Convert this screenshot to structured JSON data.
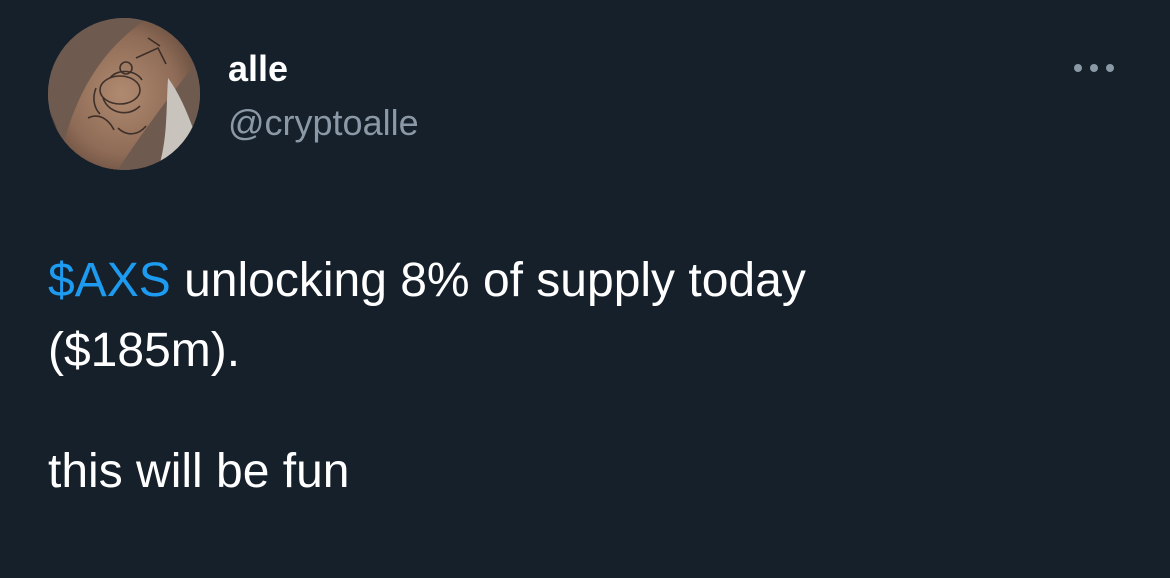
{
  "author": {
    "display_name": "alle",
    "handle": "@cryptoalle",
    "avatar_icon": "tattooed-arm-avatar-icon"
  },
  "more_icon": "ellipsis-icon",
  "tweet": {
    "line1_cashtag": "$AXS",
    "line1_rest": " unlocking 8% of supply today",
    "line2": "($185m).",
    "paragraph2": "this will be fun"
  },
  "colors": {
    "background": "#15202b",
    "primary_text": "#ffffff",
    "secondary_text": "#8b98a5",
    "link": "#1d9bf0"
  }
}
